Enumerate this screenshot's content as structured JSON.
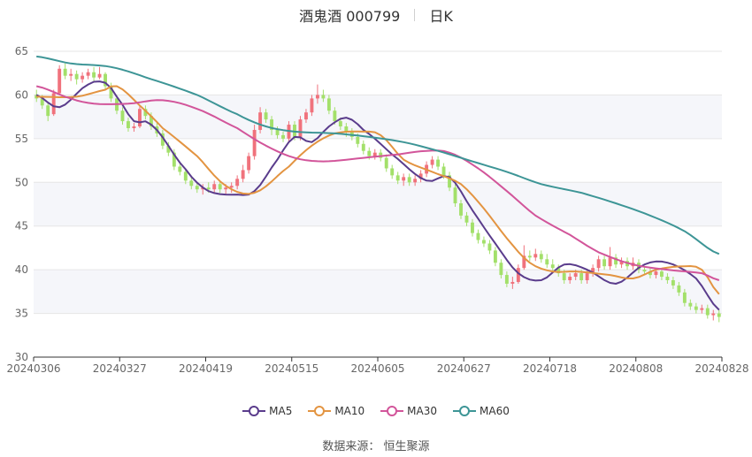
{
  "title": {
    "name": "酒鬼酒 000799",
    "period": "日K"
  },
  "source_text": "数据来源：  恒生聚源",
  "colors": {
    "up": "#f0727c",
    "down": "#a3e06a",
    "ma5": "#5a3c8c",
    "ma10": "#e39441",
    "ma30": "#d2559a",
    "ma60": "#3d9596",
    "grid": "#e6e6e6",
    "band": "#f5f6fa",
    "axis_text": "#666666"
  },
  "chart_data": {
    "type": "candlestick",
    "ylim": [
      30,
      65
    ],
    "yticks": [
      30,
      35,
      40,
      45,
      50,
      55,
      60,
      65
    ],
    "xtick_labels": [
      "20240306",
      "20240327",
      "20240419",
      "20240515",
      "20240605",
      "20240627",
      "20240718",
      "20240808",
      "20240828"
    ],
    "legend": [
      "MA5",
      "MA10",
      "MA30",
      "MA60"
    ],
    "legend_position": "bottom",
    "n_bars": 120,
    "candles": [
      [
        60,
        59.6,
        60.6,
        59.2
      ],
      [
        59.6,
        58.8,
        60.0,
        58.4
      ],
      [
        58.8,
        57.6,
        59.2,
        57.0
      ],
      [
        57.8,
        60.2,
        60.6,
        57.6
      ],
      [
        60.2,
        63.0,
        63.4,
        60.0
      ],
      [
        63.0,
        62.2,
        63.6,
        61.8
      ],
      [
        62.2,
        62.4,
        63.0,
        61.6
      ],
      [
        62.4,
        61.8,
        62.8,
        61.2
      ],
      [
        61.8,
        62.2,
        62.6,
        61.4
      ],
      [
        62.2,
        62.6,
        63.0,
        61.8
      ],
      [
        62.6,
        62.0,
        63.2,
        61.6
      ],
      [
        62.0,
        62.4,
        63.2,
        61.8
      ],
      [
        62.4,
        61.0,
        62.6,
        60.6
      ],
      [
        61.0,
        59.6,
        61.4,
        59.2
      ],
      [
        59.6,
        58.2,
        60.0,
        57.8
      ],
      [
        58.2,
        57.0,
        58.6,
        56.6
      ],
      [
        57.0,
        56.2,
        57.4,
        55.8
      ],
      [
        56.2,
        56.4,
        56.8,
        55.8
      ],
      [
        56.4,
        58.4,
        58.8,
        56.2
      ],
      [
        58.4,
        57.6,
        58.8,
        57.2
      ],
      [
        57.6,
        56.4,
        58.0,
        56.0
      ],
      [
        56.4,
        55.6,
        56.8,
        55.2
      ],
      [
        55.6,
        54.2,
        56.0,
        53.8
      ],
      [
        54.2,
        53.4,
        54.6,
        53.0
      ],
      [
        53.4,
        51.8,
        53.8,
        51.4
      ],
      [
        51.8,
        51.2,
        52.2,
        50.8
      ],
      [
        51.2,
        50.2,
        51.6,
        49.8
      ],
      [
        50.2,
        49.6,
        50.6,
        49.2
      ],
      [
        49.6,
        49.2,
        50.0,
        48.8
      ],
      [
        49.2,
        49.4,
        49.8,
        48.6
      ],
      [
        49.4,
        49.2,
        50.0,
        48.8
      ],
      [
        49.2,
        49.8,
        50.2,
        48.8
      ],
      [
        49.8,
        49.2,
        50.2,
        48.8
      ],
      [
        49.2,
        49.4,
        49.8,
        48.6
      ],
      [
        49.4,
        49.6,
        50.0,
        48.8
      ],
      [
        49.6,
        50.4,
        50.8,
        49.2
      ],
      [
        50.4,
        51.4,
        52.0,
        50.0
      ],
      [
        51.4,
        53.0,
        53.4,
        51.0
      ],
      [
        53.0,
        56.0,
        56.6,
        52.6
      ],
      [
        56.0,
        58.0,
        58.6,
        55.6
      ],
      [
        58.0,
        57.2,
        58.4,
        56.8
      ],
      [
        57.2,
        56.0,
        57.6,
        55.4
      ],
      [
        56.0,
        55.4,
        56.4,
        55.0
      ],
      [
        55.4,
        55.0,
        55.8,
        54.6
      ],
      [
        55.0,
        56.6,
        57.0,
        54.6
      ],
      [
        56.6,
        55.2,
        57.0,
        54.8
      ],
      [
        55.2,
        57.2,
        57.6,
        54.8
      ],
      [
        57.2,
        58.0,
        58.4,
        56.8
      ],
      [
        58.0,
        59.6,
        60.0,
        57.6
      ],
      [
        59.6,
        60.0,
        61.2,
        59.0
      ],
      [
        60.0,
        59.6,
        60.6,
        59.2
      ],
      [
        59.6,
        58.2,
        60.0,
        57.8
      ],
      [
        58.2,
        57.0,
        58.6,
        56.6
      ],
      [
        57.0,
        56.4,
        57.4,
        56.0
      ],
      [
        56.4,
        55.8,
        56.8,
        55.2
      ],
      [
        55.8,
        55.2,
        56.2,
        54.8
      ],
      [
        55.2,
        54.4,
        55.6,
        54.0
      ],
      [
        54.4,
        53.6,
        54.8,
        53.2
      ],
      [
        53.6,
        53.0,
        54.0,
        52.6
      ],
      [
        53.0,
        53.4,
        53.8,
        52.6
      ],
      [
        53.4,
        52.8,
        53.8,
        52.4
      ],
      [
        52.8,
        51.6,
        53.2,
        51.2
      ],
      [
        51.6,
        50.8,
        52.0,
        50.4
      ],
      [
        50.8,
        50.2,
        51.2,
        49.8
      ],
      [
        50.2,
        50.6,
        51.0,
        49.6
      ],
      [
        50.6,
        50.0,
        51.0,
        49.6
      ],
      [
        50.0,
        50.4,
        50.8,
        49.6
      ],
      [
        50.4,
        51.0,
        51.4,
        50.0
      ],
      [
        51.0,
        52.0,
        52.4,
        50.6
      ],
      [
        52.0,
        52.6,
        53.0,
        51.6
      ],
      [
        52.6,
        51.8,
        53.0,
        51.4
      ],
      [
        51.8,
        50.8,
        52.2,
        50.4
      ],
      [
        50.8,
        49.4,
        51.2,
        49.0
      ],
      [
        49.4,
        47.6,
        49.8,
        47.2
      ],
      [
        47.6,
        46.2,
        48.0,
        45.8
      ],
      [
        46.2,
        45.4,
        46.6,
        45.0
      ],
      [
        45.4,
        44.2,
        45.8,
        43.8
      ],
      [
        44.2,
        43.4,
        44.6,
        43.0
      ],
      [
        43.4,
        43.0,
        43.8,
        42.6
      ],
      [
        43.0,
        42.2,
        43.4,
        41.8
      ],
      [
        42.2,
        40.8,
        42.6,
        40.4
      ],
      [
        40.8,
        39.4,
        41.2,
        39.0
      ],
      [
        39.4,
        38.4,
        39.8,
        38.0
      ],
      [
        38.4,
        38.6,
        39.2,
        37.8
      ],
      [
        38.6,
        40.2,
        40.6,
        38.4
      ],
      [
        40.2,
        41.6,
        42.8,
        40.0
      ],
      [
        41.6,
        41.4,
        42.2,
        41.0
      ],
      [
        41.4,
        41.8,
        42.4,
        41.0
      ],
      [
        41.8,
        41.2,
        42.2,
        40.8
      ],
      [
        41.2,
        40.6,
        41.8,
        40.2
      ],
      [
        40.6,
        40.2,
        41.2,
        39.8
      ],
      [
        40.2,
        39.6,
        40.6,
        39.2
      ],
      [
        39.6,
        38.8,
        40.0,
        38.4
      ],
      [
        38.8,
        39.2,
        39.6,
        38.4
      ],
      [
        39.2,
        39.6,
        40.0,
        38.8
      ],
      [
        39.6,
        38.8,
        40.0,
        38.4
      ],
      [
        38.8,
        39.6,
        40.0,
        38.4
      ],
      [
        39.6,
        40.2,
        40.6,
        39.2
      ],
      [
        40.2,
        41.2,
        41.6,
        39.8
      ],
      [
        41.2,
        40.4,
        41.6,
        40.0
      ],
      [
        40.4,
        41.4,
        42.6,
        40.0
      ],
      [
        41.4,
        40.6,
        41.8,
        40.2
      ],
      [
        40.6,
        41.0,
        41.4,
        40.2
      ],
      [
        41.0,
        40.4,
        41.4,
        40.0
      ],
      [
        40.4,
        40.8,
        41.4,
        40.0
      ],
      [
        40.8,
        40.0,
        41.2,
        39.6
      ],
      [
        40.0,
        39.8,
        40.4,
        39.4
      ],
      [
        39.8,
        39.4,
        40.2,
        39.0
      ],
      [
        39.4,
        39.8,
        40.2,
        39.0
      ],
      [
        39.8,
        39.2,
        40.2,
        38.8
      ],
      [
        39.2,
        38.8,
        39.6,
        38.4
      ],
      [
        38.8,
        38.2,
        39.2,
        37.8
      ],
      [
        38.2,
        37.4,
        38.6,
        37.0
      ],
      [
        37.4,
        36.2,
        37.8,
        35.8
      ],
      [
        36.2,
        35.8,
        36.6,
        35.4
      ],
      [
        35.8,
        35.4,
        36.2,
        35.0
      ],
      [
        35.4,
        35.6,
        36.0,
        35.0
      ],
      [
        35.6,
        34.8,
        36.0,
        34.4
      ],
      [
        34.8,
        35.0,
        35.4,
        34.2
      ],
      [
        35.0,
        34.6,
        35.4,
        34.0
      ]
    ],
    "ma_series": [
      {
        "name": "MA5",
        "keys": [
          [
            0,
            60.0
          ],
          [
            4,
            58.6
          ],
          [
            9,
            61.2
          ],
          [
            12,
            61.4
          ],
          [
            14,
            59.8
          ],
          [
            17,
            57.0
          ],
          [
            20,
            56.6
          ],
          [
            26,
            51.5
          ],
          [
            30,
            49.0
          ],
          [
            35,
            48.6
          ],
          [
            38,
            49.0
          ],
          [
            42,
            52.6
          ],
          [
            45,
            55.2
          ],
          [
            48,
            54.6
          ],
          [
            51,
            56.4
          ],
          [
            54,
            57.4
          ],
          [
            57,
            56.0
          ],
          [
            62,
            53.2
          ],
          [
            68,
            50.2
          ],
          [
            72,
            50.6
          ],
          [
            76,
            46.8
          ],
          [
            80,
            43.0
          ],
          [
            84,
            39.6
          ],
          [
            88,
            38.8
          ],
          [
            92,
            40.6
          ],
          [
            96,
            40.0
          ],
          [
            101,
            38.4
          ],
          [
            106,
            40.6
          ],
          [
            110,
            40.8
          ],
          [
            115,
            39.0
          ],
          [
            119,
            35.4
          ]
        ]
      },
      {
        "name": "MA10",
        "keys": [
          [
            0,
            59.8
          ],
          [
            7,
            59.8
          ],
          [
            12,
            60.6
          ],
          [
            14,
            61.0
          ],
          [
            18,
            58.8
          ],
          [
            22,
            56.2
          ],
          [
            28,
            53.0
          ],
          [
            33,
            49.6
          ],
          [
            38,
            48.8
          ],
          [
            44,
            51.8
          ],
          [
            48,
            54.2
          ],
          [
            52,
            55.6
          ],
          [
            57,
            55.8
          ],
          [
            60,
            55.4
          ],
          [
            64,
            52.6
          ],
          [
            69,
            51.2
          ],
          [
            74,
            49.8
          ],
          [
            78,
            47.0
          ],
          [
            82,
            43.6
          ],
          [
            86,
            40.8
          ],
          [
            90,
            39.8
          ],
          [
            94,
            39.8
          ],
          [
            100,
            39.4
          ],
          [
            104,
            39.0
          ],
          [
            108,
            40.0
          ],
          [
            113,
            40.4
          ],
          [
            116,
            40.0
          ],
          [
            119,
            37.2
          ]
        ]
      },
      {
        "name": "MA30",
        "keys": [
          [
            0,
            61.0
          ],
          [
            6,
            59.6
          ],
          [
            10,
            59.0
          ],
          [
            16,
            59.0
          ],
          [
            22,
            59.4
          ],
          [
            28,
            58.4
          ],
          [
            35,
            56.2
          ],
          [
            40,
            54.2
          ],
          [
            45,
            52.8
          ],
          [
            50,
            52.4
          ],
          [
            57,
            52.8
          ],
          [
            63,
            53.2
          ],
          [
            68,
            53.6
          ],
          [
            72,
            53.4
          ],
          [
            77,
            51.6
          ],
          [
            82,
            49.0
          ],
          [
            87,
            46.2
          ],
          [
            93,
            44.0
          ],
          [
            98,
            42.0
          ],
          [
            104,
            40.6
          ],
          [
            110,
            40.0
          ],
          [
            116,
            39.6
          ],
          [
            119,
            38.8
          ]
        ]
      },
      {
        "name": "MA60",
        "keys": [
          [
            0,
            64.4
          ],
          [
            6,
            63.6
          ],
          [
            13,
            63.2
          ],
          [
            20,
            61.8
          ],
          [
            28,
            60.0
          ],
          [
            35,
            57.8
          ],
          [
            40,
            56.4
          ],
          [
            45,
            55.8
          ],
          [
            52,
            55.6
          ],
          [
            58,
            55.2
          ],
          [
            64,
            54.6
          ],
          [
            70,
            53.6
          ],
          [
            76,
            52.4
          ],
          [
            82,
            51.2
          ],
          [
            88,
            49.8
          ],
          [
            95,
            48.8
          ],
          [
            101,
            47.6
          ],
          [
            107,
            46.2
          ],
          [
            113,
            44.4
          ],
          [
            119,
            41.8
          ]
        ]
      }
    ]
  }
}
